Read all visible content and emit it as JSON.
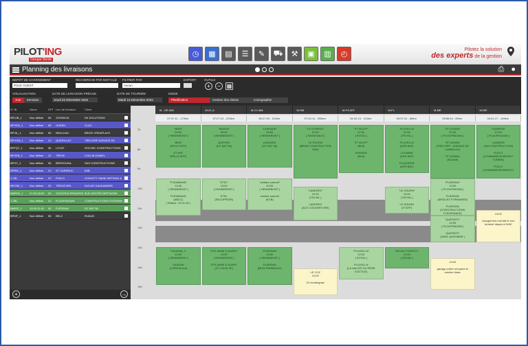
{
  "header": {
    "logo_main": "PILOT",
    "logo_accent": "'ING",
    "logo_sub": "Groupe Bonte",
    "tagline_1": "Pilotez la solution",
    "tagline_2": "des experts",
    "tagline_3": "de la gestion",
    "apps": [
      {
        "name": "clock-app-icon",
        "color": "#4a5bd8",
        "glyph": "◷"
      },
      {
        "name": "grid-app-icon",
        "color": "#3a6fd0",
        "glyph": "▦"
      },
      {
        "name": "form-app-icon",
        "color": "#5a5a5a",
        "glyph": "▤"
      },
      {
        "name": "list-app-icon",
        "color": "#5a5a5a",
        "glyph": "☰"
      },
      {
        "name": "edit-app-icon",
        "color": "#5a5a5a",
        "glyph": "✎"
      },
      {
        "name": "truck-app-icon",
        "color": "#5a5a5a",
        "glyph": "⛟"
      },
      {
        "name": "tools-app-icon",
        "color": "#5a5a5a",
        "glyph": "⚒"
      },
      {
        "name": "green-app-icon",
        "color": "#7bbf3c",
        "glyph": "▣"
      },
      {
        "name": "green-app-icon-2",
        "color": "#58b04a",
        "glyph": "▥"
      },
      {
        "name": "history-app-icon",
        "color": "#d93a2a",
        "glyph": "◴"
      }
    ]
  },
  "titlebar": {
    "title": "Planning des livraisons"
  },
  "filters": {
    "depot_label": "Dépôt de chargement",
    "depot_value": "POLE OUEST",
    "search_label": "Recherche par mot-clé",
    "search_value": "",
    "filter_label": "Filtrer par",
    "filter_value": "Aucun",
    "export_label": "Export",
    "tools_label": "Outils",
    "view_label": "Visualisation",
    "view_options": [
      "Jour",
      "Semaine"
    ],
    "delivery_date_label": "Date de livraison prévue",
    "delivery_date_value": "Jeudi 22 Décembre 2022",
    "tour_date_label": "Date de tournée",
    "tour_date_value": "Mardi 13 Décembre 2022",
    "mode_label": "Mode",
    "mode_options": [
      "Planification",
      "Gestion des clients",
      "Cartographie"
    ]
  },
  "left_table": {
    "columns": [
      "N° BL",
      "Heure",
      "DPT",
      "Lieu de livraison",
      "Client"
    ],
    "rows": [
      {
        "bl": "BPL0B_1",
        "heure": "Non définie",
        "dpt": "56",
        "lieu": "JOSSELIN",
        "client": "DK SOLUTIONS",
        "color": "#3a3a3a"
      },
      {
        "bl": "BPVDN_1",
        "heure": "Non définie",
        "dpt": "56",
        "lieu": "GUIDEL",
        "client": "CLAC",
        "color": "#5858c8"
      },
      {
        "bl": "BPVIL_1",
        "heure": "Non définie",
        "dpt": "56",
        "lieu": "NEULLIAC",
        "client": "BRICE CREAPLAYS",
        "color": "#3a3a3a"
      },
      {
        "bl": "BPVGM_1",
        "heure": "Non définie",
        "dpt": "22",
        "lieu": "QUEDILLAC",
        "client": "TRECORP AGENCE DE",
        "color": "#5858c8"
      },
      {
        "bl": "BPFQT_1",
        "heure": "Non définie",
        "dpt": "56",
        "lieu": "LOYAT",
        "client": "ROCHEL CONSTRUCTIONS",
        "color": "#3a3a3a"
      },
      {
        "bl": "BPXDB_1",
        "heure": "Non définie",
        "dpt": "22",
        "lieu": "TREVE",
        "client": "COLLIN DANIEL",
        "color": "#5858c8"
      },
      {
        "bl": "BPGY_1",
        "heure": "Non définie",
        "dpt": "56",
        "lieu": "BERHOUNA",
        "client": "SAS CONSTRUCTIONS",
        "color": "#3a3a3a"
      },
      {
        "bl": "BPRIK_1",
        "heure": "Non définie",
        "dpt": "22",
        "lieu": "ST CARREUC",
        "client": "BIIB",
        "color": "#5858c8"
      },
      {
        "bl": "1-78L",
        "heure": "Non définie",
        "dpt": "22",
        "lieu": "PLELO",
        "client": "CHOLETT HAINE ARTISAN & GLOBO",
        "color": "#5858c8"
      },
      {
        "bl": "BPCBE_1",
        "heure": "Non définie",
        "dpt": "29",
        "lieu": "TREGOVEN",
        "client": "KUCUR GAUDAMERE",
        "color": "#5858c8"
      },
      {
        "bl": "BMRSK_1",
        "heure": "07:00-08:00",
        "dpt": "56",
        "lieu": "GOUSTAN RENARDS",
        "client": "BLB CENTRE BRETAGNE",
        "color": "#5aa05a"
      },
      {
        "bl": "1 ZBL",
        "heure": "Non définie",
        "dpt": "22",
        "lieu": "PLOUFRAGAN",
        "client": "CONSTRUCTIONS PLÉDRANAIS",
        "color": "#5aa05a"
      },
      {
        "bl": "BMISE_1",
        "heure": "10:00-11:00",
        "dpt": "56",
        "lieu": "PLEDRAN",
        "client": "DC BAT 56",
        "color": "#5aa05a"
      },
      {
        "bl": "BPMF_1",
        "heure": "Non définie",
        "dpt": "56",
        "lieu": "BELZ",
        "client": "RUAUD",
        "color": "#3a3a3a"
      }
    ]
  },
  "planning": {
    "vehicles": [
      {
        "label": "M - GE-455",
        "km": "07:47-11 - 172km"
      },
      {
        "label": "M-ZL-A",
        "km": "07:27-24 - 223km"
      },
      {
        "label": "M-CJ-484",
        "km": "06:27:09 - 112km"
      },
      {
        "label": "M-SM",
        "km": "07:44-11 - 206km"
      },
      {
        "label": "M-FS-007",
        "km": "04:42-13 - 121km"
      },
      {
        "label": "M-FL",
        "km": "05:37-01 - 86km"
      },
      {
        "label": "M-ME",
        "km": "05:56:44 - 82km"
      },
      {
        "label": "M-WE",
        "km": "04:41-17 - 149km"
      }
    ],
    "hours": [
      "7h",
      "8h",
      "9h",
      "10h",
      "11h",
      "12h",
      "13h",
      "14h",
      "15h"
    ],
    "slots": [
      {
        "col": 0,
        "row": 0,
        "span": 4.0,
        "style": "g-dark",
        "lines": [
          "\"BDW\"",
          "09:00",
          "[ HENNEBONT ]",
          "",
          "BDW",
          "(PELLE BTP)",
          "",
          "ST AVE",
          "(PELLE BTP)"
        ]
      },
      {
        "col": 1,
        "row": 0,
        "span": 4.0,
        "style": "g-dark",
        "lines": [
          "\"BADER\"",
          "09:00",
          "[ HENNEBONT ]",
          "",
          "QUEVEN",
          "(DC BAT 56)"
        ]
      },
      {
        "col": 2,
        "row": 0,
        "span": 4.0,
        "style": "g-dark",
        "lines": [
          "\"LANGADE\"",
          "09:00",
          "[ HENNEBONT ]",
          "",
          "LANGADE",
          "(DC BAT 56)"
        ]
      },
      {
        "col": 3,
        "row": 0,
        "span": 5.0,
        "style": "g-dark",
        "lines": [
          "\"LE GORRAY\"",
          "07:00",
          "[ SIGNOVALE ]",
          "",
          "LE SOURN",
          "(MENE CONSTRUCTION",
          "SAS)"
        ]
      },
      {
        "col": 4,
        "row": 0,
        "span": 4.5,
        "style": "g-dark",
        "lines": [
          "\"ST NOLFF\"",
          "07:00",
          "[ ROYAL ]",
          "",
          "ST NOLFF",
          "(BLB)",
          "",
          "RHENAN",
          "(BLB)"
        ]
      },
      {
        "col": 5,
        "row": 0,
        "span": 4.5,
        "style": "g-dark",
        "lines": [
          "PLUVELLN",
          "07:00",
          "[ ROYAL ]",
          "",
          "PLUVELLN",
          "(KER BAT)",
          "",
          "LOCMINE",
          "(KER BAT)",
          "",
          "PLAUDREN",
          "(KER BAT)"
        ]
      },
      {
        "col": 6,
        "row": 0,
        "span": 5.0,
        "style": "g-dark",
        "lines": [
          "\"ST DONAN\"",
          "07:00",
          "[ PLOUFRAGAN ]",
          "",
          "ST DONAN",
          "(TRECORP - AGENCE DE",
          "LAMBALLE)",
          "",
          "ST DONAN",
          "(MUGNI)"
        ]
      },
      {
        "col": 7,
        "row": 0,
        "span": 5.0,
        "style": "g-dark",
        "lines": [
          "\"LANNION\"",
          "07:00",
          "[ PLOUFRAGAN ]",
          "",
          "LANNION",
          "(GM CONSTRUCTION)",
          "",
          "PLELO",
          "(CHAMARRON BENOIT",
          "TURBIN)",
          "",
          "PLELO",
          "(CHAMARRON BENOIT)"
        ]
      },
      {
        "col": 1,
        "row": 5.0,
        "span": 3.0,
        "style": "g-light",
        "lines": [
          "\"ETEL\"",
          "10:00",
          "[ HENNEBONT ]",
          "",
          "ETEL",
          "(SECOPRIOR)"
        ]
      },
      {
        "col": 2,
        "row": 5.0,
        "span": 3.0,
        "style": "g-light",
        "lines": [
          "\"clohars carnoet\"",
          "10:00",
          "[ HENNEBONT ]",
          "",
          "clohars carnoet",
          "(ECB)"
        ]
      },
      {
        "col": 0,
        "row": 5.0,
        "span": 3.5,
        "style": "g-light",
        "lines": [
          "\"PLEMMAND\"",
          "10:00",
          "[ HENNEBONT ]",
          "",
          "PLEMMAND",
          "(ABCC)",
          "( Retard : 00:11:45 )"
        ]
      },
      {
        "col": 3,
        "row": 5.8,
        "span": 3.2,
        "style": "g-light",
        "lines": [
          "\"LANDREZ\"",
          "10:30",
          "[ ROYAL ]",
          "",
          "LANDREZ",
          "(ACS COUVERTURE)"
        ]
      },
      {
        "col": 5,
        "row": 5.8,
        "span": 2.5,
        "style": "g-light",
        "lines": [
          "\"LE SOURN\"",
          "10:00",
          "[ ROYAL ]",
          "",
          "LE SOURN",
          "(IT BTP)"
        ]
      },
      {
        "col": 6,
        "row": 5.0,
        "span": 3.5,
        "style": "g-light",
        "lines": [
          "\"PLEDRAN\"",
          "10:00",
          "[ PLOUFRAGAN ]",
          "",
          "PLEDRAN",
          "(ARGILEX FORMARED)",
          "",
          "PLEDRAN",
          "(CONSTRUCTIONS",
          "PLEDRANAIS)"
        ]
      },
      {
        "col": 6,
        "row": 8.5,
        "span": 2.5,
        "style": "g-light",
        "lines": [
          "\"QUESSOY\"",
          "12:00",
          "[ PLOUFRAGAN ]",
          "",
          "QUESSOY",
          "(SARL QUEHAMR )"
        ]
      },
      {
        "col": 7,
        "row": 8.0,
        "span": 3.0,
        "style": "y-slot",
        "lines": [
          "13:00",
          "",
          "chargement mal fait et non",
          "terminé départ à 9h30"
        ]
      },
      {
        "col": 0,
        "row": 11.5,
        "span": 3.5,
        "style": "g-dark",
        "lines": [
          "\"CAUDAN_1\"",
          "13:00",
          "[ HENNEBONT ]",
          "",
          "CAUDAN",
          "(CORKIA sud)"
        ]
      },
      {
        "col": 1,
        "row": 11.5,
        "span": 3.5,
        "style": "g-dark",
        "lines": [
          "\"STE ANNE D AURAY\"",
          "13:00",
          "[ HENNEBONT ]",
          "",
          "STE ANNE D AURAY",
          "(ST LOUIS SP)"
        ]
      },
      {
        "col": 2,
        "row": 11.5,
        "span": 3.5,
        "style": "g-dark",
        "lines": [
          "\"PLEDRAN\"",
          "13:00",
          "[ HENNEBONT ]",
          "",
          "PLEDRAN",
          "(MCM PANNEAUX)"
        ]
      },
      {
        "col": 4,
        "row": 11.5,
        "span": 3.0,
        "style": "g-light",
        "lines": [
          "\"PLUVELLN\"",
          "12:00",
          "[ ROYAL ]",
          "",
          "PLUVELLN",
          "(LA VALLÉE DU PERE",
          "KOCTUS)"
        ]
      },
      {
        "col": 5,
        "row": 11.5,
        "span": 2.0,
        "style": "g-dark",
        "lines": [
          "\"ROYAL PONTIVY\"",
          "12:00",
          "[ ROYAL ]"
        ]
      },
      {
        "col": 3,
        "row": 13.5,
        "span": 2.5,
        "style": "y-slot",
        "lines": [
          "LE COZ",
          "14:00",
          "",
          "22 mordingnac"
        ]
      },
      {
        "col": 6,
        "row": 12.5,
        "span": 3.0,
        "style": "y-slot",
        "lines": [
          "14:00",
          "",
          "garage police recupera le",
          "camion blanc"
        ]
      }
    ]
  }
}
